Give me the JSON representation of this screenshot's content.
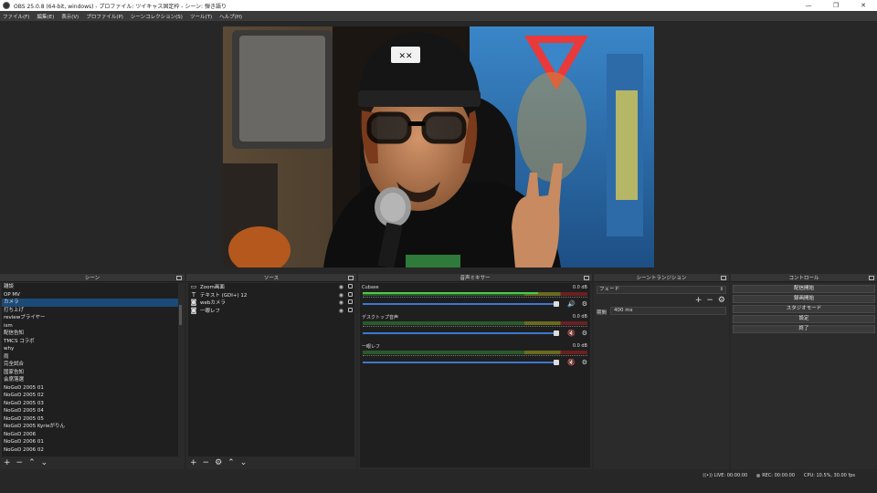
{
  "window": {
    "title": "OBS 25.0.8 (64-bit, windows) - プロファイル: ツイキャス固定枠 - シーン: 弾き語り",
    "controls": [
      "—",
      "❐",
      "✕"
    ]
  },
  "menu": [
    "ファイル(F)",
    "編集(E)",
    "表示(V)",
    "プロファイル(P)",
    "シーンコレクション(S)",
    "ツール(T)",
    "ヘルプ(H)"
  ],
  "docks": {
    "scenes": "シーン",
    "sources": "ソース",
    "mixer": "音声ミキサー",
    "transitions": "シーントランジション",
    "controls": "コントロール"
  },
  "scenes": [
    "雑談",
    "OP MV",
    "カメラ",
    "打ち上げ",
    "reviewプライヤー",
    "ism",
    "配信告知",
    "TMCS コラボ",
    "why",
    "雨",
    "完全試合",
    "国家告知",
    "会席落選",
    "NoGoD 2005 01",
    "NoGoD 2005 02",
    "NoGoD 2005 03",
    "NoGoD 2005 04",
    "NoGoD 2005 05",
    "NoGoD 2005 Kyrieがりん",
    "NoGoD 2006",
    "NoGoD 2006 01",
    "NoGoD 2006 02"
  ],
  "selected_scene_index": 2,
  "sources": [
    {
      "name": "Zoom画面",
      "icon": "▭"
    },
    {
      "name": "テキスト (GDI+) 12",
      "icon": "T"
    },
    {
      "name": "webカメラ",
      "icon": "◙"
    },
    {
      "name": "一眼レフ",
      "icon": "◙"
    }
  ],
  "mixer": [
    {
      "name": "Cubase",
      "db": "0.0 dB",
      "level": 0.78,
      "muted": false
    },
    {
      "name": "デスクトップ音声",
      "db": "0.0 dB",
      "level": 0.0,
      "muted": true
    },
    {
      "name": "一眼レフ",
      "db": "0.0 dB",
      "level": 0.0,
      "muted": true
    }
  ],
  "transitions": {
    "selected": "フェード",
    "duration_label": "期間",
    "duration": "400 ms"
  },
  "controls": [
    "配信開始",
    "録画開始",
    "スタジオモード",
    "設定",
    "終了"
  ],
  "status": {
    "live": "LIVE: 00:00:00",
    "rec": "REC: 00:00:00",
    "cpu": "CPU: 10.5%, 30.00 fps"
  },
  "colors": {
    "background": "#272727",
    "selection": "#1b4a78",
    "fader": "#3d78d0",
    "muted": "#e04040"
  }
}
